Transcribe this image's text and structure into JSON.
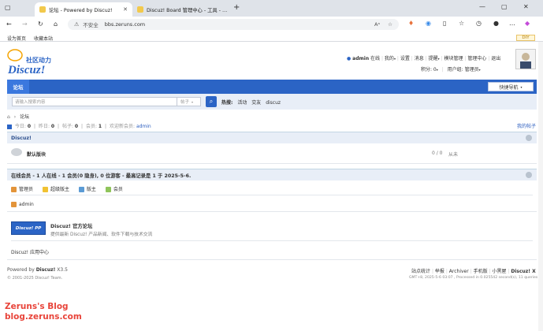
{
  "browser": {
    "tabs": [
      {
        "title": "论坛 - Powered by Discuz!"
      },
      {
        "title": "Discuz! Board 管理中心 - 工具 - …"
      }
    ],
    "new_tab": "+",
    "url_warning": "不安全",
    "url": "bbs.zeruns.com",
    "bookmarks": [
      "设为首页",
      "收藏本站"
    ],
    "diy_button": "DIY"
  },
  "header": {
    "logo_text": "Discuz!",
    "logo_sub": "社区动力",
    "user": "admin",
    "status": "在线",
    "links": [
      "我的",
      "设置",
      "消息",
      "提醒",
      "模块管理",
      "管理中心",
      "退出"
    ],
    "credits": "积分: 0",
    "usergroup": "用户组: 管理员"
  },
  "nav": {
    "forum_tab": "论坛",
    "quick_nav": "快捷导航"
  },
  "search": {
    "placeholder": "请输入搜索内容",
    "type": "帖子",
    "hot_label": "热搜:",
    "hot_terms": [
      "活动",
      "交友",
      "discuz"
    ]
  },
  "breadcrumb": {
    "home_icon": "home-icon",
    "separator": "›",
    "current": "论坛"
  },
  "stats": {
    "today_label": "今日:",
    "today": "0",
    "yesterday_label": "昨日:",
    "yesterday": "0",
    "posts_label": "帖子:",
    "posts": "0",
    "members_label": "会员:",
    "members": "1",
    "welcome_label": "欢迎新会员:",
    "new_member": "admin",
    "my_posts": "我的帖子"
  },
  "forum_category": {
    "title": "Discuz!",
    "boards": [
      {
        "name": "默认版块",
        "counts": "0 / 0",
        "last": "从未"
      }
    ]
  },
  "online": {
    "title": "在线会员 - 1 人在线 - 1 会员(0 隐身), 0 位游客 - 最高记录是 1 于 2025-5-6.",
    "legend": [
      "管理员",
      "超级版主",
      "版主",
      "会员"
    ],
    "users": [
      "admin"
    ]
  },
  "links_section": {
    "logo_text": "Discuz! PP",
    "title": "Discuz! 官方论坛",
    "desc": "提供最新 Discuz! 产品新闻、软件下载与技术交流",
    "app_center": "Discuz! 应用中心"
  },
  "footer": {
    "powered_by": "Powered by",
    "brand": "Discuz!",
    "version": "X3.5",
    "copyright": "© 2001-2025 Discuz! Team.",
    "links": [
      "站点统计",
      "举报",
      "Archiver",
      "手机版",
      "小黑屋",
      "Discuz! X"
    ],
    "runtime": "GMT+8, 2025-5-6 03:07 , Processed in 0.025542 second(s), 11 queries ."
  },
  "watermark": {
    "line1": "Zeruns's Blog",
    "line2": "blog.zeruns.com"
  },
  "colors": {
    "nav_blue": "#2b64c5",
    "link_blue": "#2b5dbf",
    "watermark_red": "#e8443a"
  }
}
